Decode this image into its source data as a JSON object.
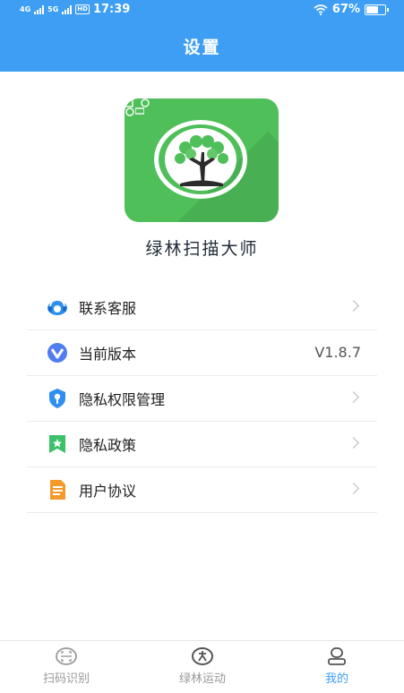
{
  "status_bar": {
    "network1": "4G",
    "network2": "5G",
    "hd": "HD",
    "time": "17:39",
    "battery": "67%"
  },
  "header": {
    "title": "设置"
  },
  "app": {
    "name": "绿林扫描大师",
    "logo_color": "#4fbf5a"
  },
  "menu": [
    {
      "label": "联系客服",
      "icon": "customer-service-icon",
      "color": "#2f8ff0"
    },
    {
      "label": "当前版本",
      "icon": "version-icon",
      "color": "#4f7ef0",
      "value": "V1.8.7"
    },
    {
      "label": "隐私权限管理",
      "icon": "privacy-shield-icon",
      "color": "#2f8ff0"
    },
    {
      "label": "隐私政策",
      "icon": "privacy-policy-icon",
      "color": "#3cc06a"
    },
    {
      "label": "用户协议",
      "icon": "user-agreement-icon",
      "color": "#f39a2b"
    }
  ],
  "tabs": [
    {
      "label": "扫码识别",
      "icon": "scan-icon",
      "active": false
    },
    {
      "label": "绿林运动",
      "icon": "sport-icon",
      "active": false
    },
    {
      "label": "我的",
      "icon": "profile-icon",
      "active": true
    }
  ],
  "colors": {
    "primary": "#3d9ef4"
  }
}
